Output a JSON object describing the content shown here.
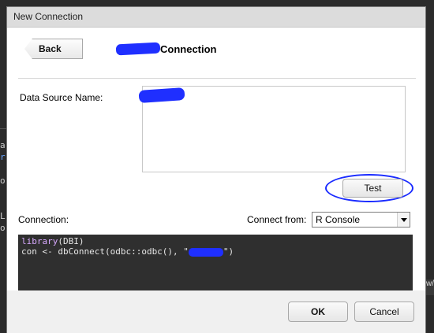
{
  "dialog": {
    "title": "New Connection",
    "back_label": "Back",
    "heading": "Connection",
    "dsn_label": "Data Source Name:",
    "test_label": "Test",
    "connection_label": "Connection:",
    "connect_from_label": "Connect from:",
    "connect_from_value": "R Console",
    "code_line1_fn": "library",
    "code_line1_rest": "(DBI)",
    "code_line2_pre": "con <- dbConnect(odbc::odbc(), \"",
    "code_line2_post": "\")",
    "ok_label": "OK",
    "cancel_label": "Cancel"
  },
  "background": {
    "left_glyphs": [
      "a",
      "r",
      "o",
      "L",
      "o"
    ],
    "right_text": "w/"
  },
  "colors": {
    "annotation": "#1a2bff",
    "code_bg": "#2f2f2f",
    "dialog_bg": "#f0f0f0"
  }
}
